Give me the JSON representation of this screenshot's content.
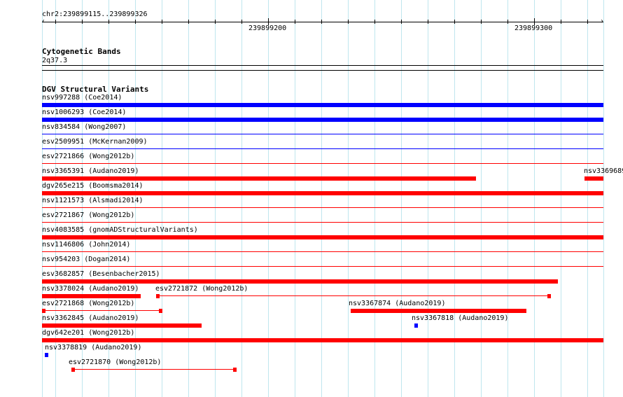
{
  "ruler": {
    "region": "chr2:239899115..239899326",
    "start": 239899115,
    "end": 239899326,
    "major_labels": [
      239899200,
      239899300
    ],
    "major_label_text": [
      "239899200",
      "239899300"
    ]
  },
  "cytoband": {
    "title": "Cytogenetic Bands",
    "band": "2q37.3"
  },
  "dgv": {
    "title": "DGV Structural Variants",
    "colors": {
      "gain": "#0000ff",
      "loss": "#ff0000"
    },
    "features": [
      {
        "label": "nsv997288 (Coe2014)",
        "color": "gain",
        "style": "thick",
        "start": 239899115,
        "end": 239899326
      },
      {
        "label": "nsv1006293 (Coe2014)",
        "color": "gain",
        "style": "thick",
        "start": 239899115,
        "end": 239899326
      },
      {
        "label": "nsv834584 (Wong2007)",
        "color": "gain",
        "style": "thin",
        "start": 239899115,
        "end": 239899326
      },
      {
        "label": "esv2509951 (McKernan2009)",
        "color": "gain",
        "style": "thin",
        "start": 239899115,
        "end": 239899326
      },
      {
        "label": "esv2721866 (Wong2012b)",
        "color": "loss",
        "style": "thin",
        "start": 239899115,
        "end": 239899326
      },
      {
        "label": "nsv3365391 (Audano2019)",
        "color": "loss",
        "style": "thick",
        "start": 239899115,
        "end": 239899278
      },
      {
        "label": "nsv3369689",
        "color": "loss",
        "style": "thick",
        "start": 239899319,
        "end": 239899326
      },
      {
        "label": "dgv265e215 (Boomsma2014)",
        "color": "loss",
        "style": "thick",
        "start": 239899115,
        "end": 239899326
      },
      {
        "label": "nsv1121573 (Alsmadi2014)",
        "color": "loss",
        "style": "thin",
        "start": 239899115,
        "end": 239899326
      },
      {
        "label": "esv2721867 (Wong2012b)",
        "color": "loss",
        "style": "thin",
        "start": 239899115,
        "end": 239899326
      },
      {
        "label": "nsv4083585 (gnomADStructuralVariants)",
        "color": "loss",
        "style": "thick",
        "start": 239899115,
        "end": 239899326
      },
      {
        "label": "nsv1146806 (John2014)",
        "color": "loss",
        "style": "thin",
        "start": 239899115,
        "end": 239899326
      },
      {
        "label": "nsv954203 (Dogan2014)",
        "color": "loss",
        "style": "thin",
        "start": 239899115,
        "end": 239899326
      },
      {
        "label": "esv3682857 (Besenbacher2015)",
        "color": "loss",
        "style": "thick",
        "start": 239899115,
        "end": 239899309
      },
      {
        "label": "nsv3378024 (Audano2019)",
        "color": "loss",
        "style": "thick",
        "start": 239899115,
        "end": 239899152
      },
      {
        "label": "esv2721872 (Wong2012b)",
        "color": "loss",
        "style": "connector",
        "start": 239899158,
        "end": 239899306
      },
      {
        "label": "esv2721868 (Wong2012b)",
        "color": "loss",
        "style": "connector",
        "start": 239899115,
        "end": 239899160
      },
      {
        "label": "nsv3367874 (Audano2019)",
        "color": "loss",
        "style": "thick",
        "start": 239899231,
        "end": 239899297
      },
      {
        "label": "nsv3362845 (Audano2019)",
        "color": "loss",
        "style": "thick",
        "start": 239899115,
        "end": 239899175
      },
      {
        "label": "nsv3367818 (Audano2019)",
        "color": "gain",
        "style": "box",
        "start": 239899255,
        "end": 239899257
      },
      {
        "label": "dgv642e201 (Wong2012b)",
        "color": "loss",
        "style": "thick",
        "start": 239899115,
        "end": 239899326
      },
      {
        "label": "nsv3378819 (Audano2019)",
        "color": "gain",
        "style": "box",
        "start": 239899116,
        "end": 239899117
      },
      {
        "label": "esv2721870 (Wong2012b)",
        "color": "loss",
        "style": "connector",
        "start": 239899126,
        "end": 239899188
      }
    ]
  }
}
